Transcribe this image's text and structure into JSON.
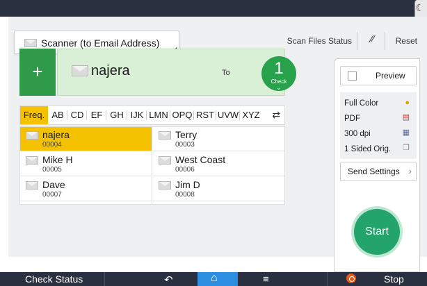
{
  "header": {
    "destination_type": "Scanner (to Email Address)",
    "scan_files_status": "Scan Files Status",
    "reset": "Reset"
  },
  "recipient": {
    "name": "najera",
    "to_label": "To",
    "count": "1",
    "check_label": "Check"
  },
  "index_tabs": [
    "Freq.",
    "AB",
    "CD",
    "EF",
    "GH",
    "IJK",
    "LMN",
    "OPQ",
    "RST",
    "UVW",
    "XYZ"
  ],
  "active_tab": "Freq.",
  "address_book": [
    {
      "name": "najera",
      "number": "00004",
      "selected": true
    },
    {
      "name": "Terry",
      "number": "00003",
      "selected": false
    },
    {
      "name": "Mike H",
      "number": "00005",
      "selected": false
    },
    {
      "name": "West Coast",
      "number": "00006",
      "selected": false
    },
    {
      "name": "Dave",
      "number": "00007",
      "selected": false
    },
    {
      "name": "Jim D",
      "number": "00008",
      "selected": false
    }
  ],
  "right_panel": {
    "preview": "Preview",
    "settings": [
      {
        "label": "Full Color",
        "icon": "color-dots-icon"
      },
      {
        "label": "PDF",
        "icon": "pdf-file-icon"
      },
      {
        "label": "300 dpi",
        "icon": "resolution-icon"
      },
      {
        "label": "1 Sided Orig.",
        "icon": "one-sided-icon"
      }
    ],
    "send_settings": "Send Settings",
    "start": "Start"
  },
  "bottom_bar": {
    "check_status": "Check Status",
    "stop": "Stop"
  },
  "colors": {
    "accent_green": "#2f9a48",
    "selection_yellow": "#f4c200",
    "start_green": "#22a46c",
    "bar_dark": "#2b3040",
    "home_blue": "#2c8ee0"
  }
}
